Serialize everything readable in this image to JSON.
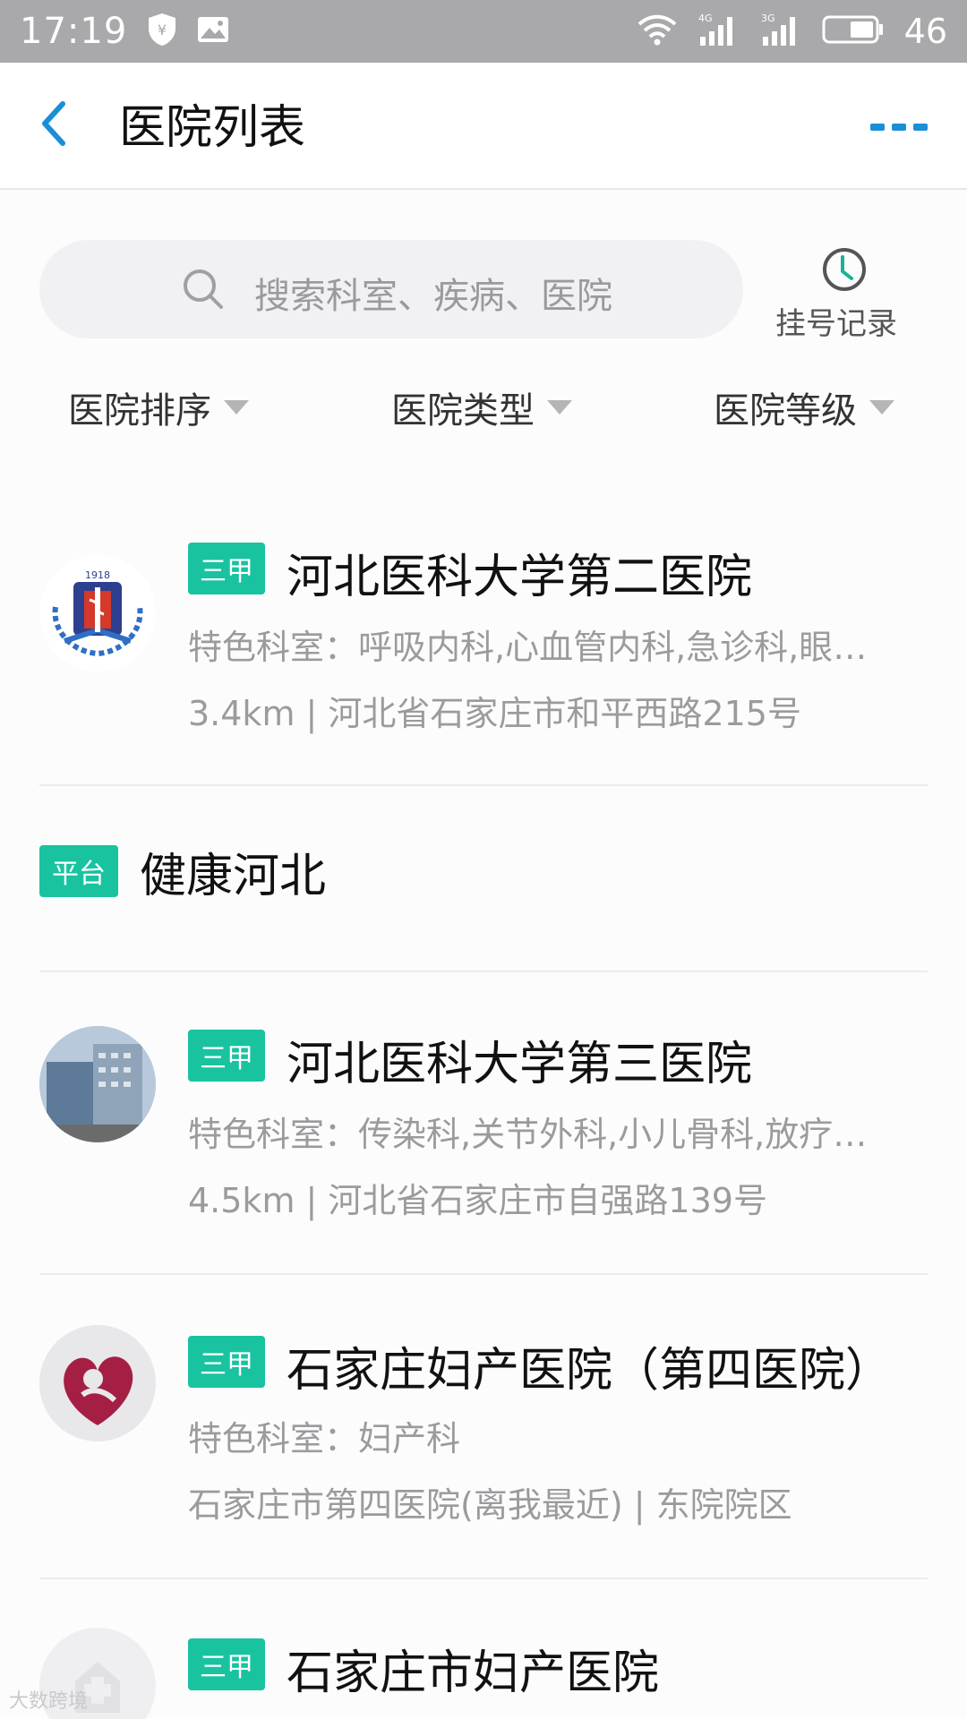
{
  "status_bar": {
    "time": "17:19",
    "battery": "46",
    "net1": "4G",
    "net2": "3G"
  },
  "header": {
    "title": "医院列表",
    "back_icon": "chevron-left-icon",
    "more_icon": "more-dots-icon"
  },
  "search": {
    "placeholder": "搜索科室、疾病、医院",
    "records_label": "挂号记录"
  },
  "filters": [
    {
      "label": "医院排序"
    },
    {
      "label": "医院类型"
    },
    {
      "label": "医院等级"
    }
  ],
  "hospitals": [
    {
      "badge": "三甲",
      "name": "河北医科大学第二医院",
      "departments": "特色科室：呼吸内科,心血管内科,急诊科,眼…",
      "address": "3.4km | 河北省石家庄市和平西路215号",
      "logo_text": "1918"
    },
    {
      "badge": "平台",
      "name": "健康河北"
    },
    {
      "badge": "三甲",
      "name": "河北医科大学第三医院",
      "departments": "特色科室：传染科,关节外科,小儿骨科,放疗…",
      "address": "4.5km | 河北省石家庄市自强路139号"
    },
    {
      "badge": "三甲",
      "name": "石家庄妇产医院（第四医院）",
      "departments": "特色科室：妇产科",
      "address": "石家庄市第四医院(离我最近) | 东院院区"
    },
    {
      "badge": "三甲",
      "name": "石家庄市妇产医院"
    }
  ],
  "watermark": "大数跨境",
  "colors": {
    "accent_blue": "#1a8fd6",
    "badge_green": "#19c3a0",
    "status_bar_gray": "#a9a9ab"
  }
}
